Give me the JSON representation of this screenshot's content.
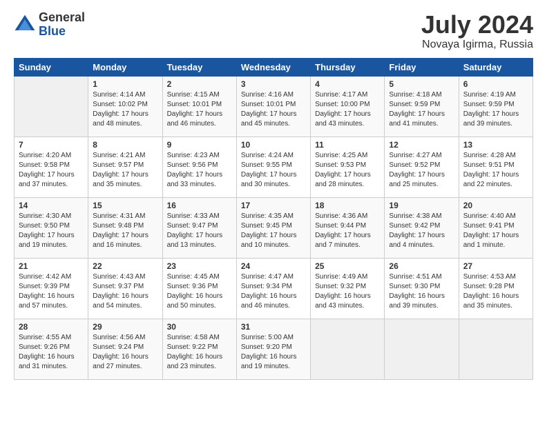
{
  "logo": {
    "general": "General",
    "blue": "Blue"
  },
  "header": {
    "month_year": "July 2024",
    "location": "Novaya Igirma, Russia"
  },
  "days_of_week": [
    "Sunday",
    "Monday",
    "Tuesday",
    "Wednesday",
    "Thursday",
    "Friday",
    "Saturday"
  ],
  "weeks": [
    [
      {
        "day": "",
        "info": ""
      },
      {
        "day": "1",
        "info": "Sunrise: 4:14 AM\nSunset: 10:02 PM\nDaylight: 17 hours\nand 48 minutes."
      },
      {
        "day": "2",
        "info": "Sunrise: 4:15 AM\nSunset: 10:01 PM\nDaylight: 17 hours\nand 46 minutes."
      },
      {
        "day": "3",
        "info": "Sunrise: 4:16 AM\nSunset: 10:01 PM\nDaylight: 17 hours\nand 45 minutes."
      },
      {
        "day": "4",
        "info": "Sunrise: 4:17 AM\nSunset: 10:00 PM\nDaylight: 17 hours\nand 43 minutes."
      },
      {
        "day": "5",
        "info": "Sunrise: 4:18 AM\nSunset: 9:59 PM\nDaylight: 17 hours\nand 41 minutes."
      },
      {
        "day": "6",
        "info": "Sunrise: 4:19 AM\nSunset: 9:59 PM\nDaylight: 17 hours\nand 39 minutes."
      }
    ],
    [
      {
        "day": "7",
        "info": "Sunrise: 4:20 AM\nSunset: 9:58 PM\nDaylight: 17 hours\nand 37 minutes."
      },
      {
        "day": "8",
        "info": "Sunrise: 4:21 AM\nSunset: 9:57 PM\nDaylight: 17 hours\nand 35 minutes."
      },
      {
        "day": "9",
        "info": "Sunrise: 4:23 AM\nSunset: 9:56 PM\nDaylight: 17 hours\nand 33 minutes."
      },
      {
        "day": "10",
        "info": "Sunrise: 4:24 AM\nSunset: 9:55 PM\nDaylight: 17 hours\nand 30 minutes."
      },
      {
        "day": "11",
        "info": "Sunrise: 4:25 AM\nSunset: 9:53 PM\nDaylight: 17 hours\nand 28 minutes."
      },
      {
        "day": "12",
        "info": "Sunrise: 4:27 AM\nSunset: 9:52 PM\nDaylight: 17 hours\nand 25 minutes."
      },
      {
        "day": "13",
        "info": "Sunrise: 4:28 AM\nSunset: 9:51 PM\nDaylight: 17 hours\nand 22 minutes."
      }
    ],
    [
      {
        "day": "14",
        "info": "Sunrise: 4:30 AM\nSunset: 9:50 PM\nDaylight: 17 hours\nand 19 minutes."
      },
      {
        "day": "15",
        "info": "Sunrise: 4:31 AM\nSunset: 9:48 PM\nDaylight: 17 hours\nand 16 minutes."
      },
      {
        "day": "16",
        "info": "Sunrise: 4:33 AM\nSunset: 9:47 PM\nDaylight: 17 hours\nand 13 minutes."
      },
      {
        "day": "17",
        "info": "Sunrise: 4:35 AM\nSunset: 9:45 PM\nDaylight: 17 hours\nand 10 minutes."
      },
      {
        "day": "18",
        "info": "Sunrise: 4:36 AM\nSunset: 9:44 PM\nDaylight: 17 hours\nand 7 minutes."
      },
      {
        "day": "19",
        "info": "Sunrise: 4:38 AM\nSunset: 9:42 PM\nDaylight: 17 hours\nand 4 minutes."
      },
      {
        "day": "20",
        "info": "Sunrise: 4:40 AM\nSunset: 9:41 PM\nDaylight: 17 hours\nand 1 minute."
      }
    ],
    [
      {
        "day": "21",
        "info": "Sunrise: 4:42 AM\nSunset: 9:39 PM\nDaylight: 16 hours\nand 57 minutes."
      },
      {
        "day": "22",
        "info": "Sunrise: 4:43 AM\nSunset: 9:37 PM\nDaylight: 16 hours\nand 54 minutes."
      },
      {
        "day": "23",
        "info": "Sunrise: 4:45 AM\nSunset: 9:36 PM\nDaylight: 16 hours\nand 50 minutes."
      },
      {
        "day": "24",
        "info": "Sunrise: 4:47 AM\nSunset: 9:34 PM\nDaylight: 16 hours\nand 46 minutes."
      },
      {
        "day": "25",
        "info": "Sunrise: 4:49 AM\nSunset: 9:32 PM\nDaylight: 16 hours\nand 43 minutes."
      },
      {
        "day": "26",
        "info": "Sunrise: 4:51 AM\nSunset: 9:30 PM\nDaylight: 16 hours\nand 39 minutes."
      },
      {
        "day": "27",
        "info": "Sunrise: 4:53 AM\nSunset: 9:28 PM\nDaylight: 16 hours\nand 35 minutes."
      }
    ],
    [
      {
        "day": "28",
        "info": "Sunrise: 4:55 AM\nSunset: 9:26 PM\nDaylight: 16 hours\nand 31 minutes."
      },
      {
        "day": "29",
        "info": "Sunrise: 4:56 AM\nSunset: 9:24 PM\nDaylight: 16 hours\nand 27 minutes."
      },
      {
        "day": "30",
        "info": "Sunrise: 4:58 AM\nSunset: 9:22 PM\nDaylight: 16 hours\nand 23 minutes."
      },
      {
        "day": "31",
        "info": "Sunrise: 5:00 AM\nSunset: 9:20 PM\nDaylight: 16 hours\nand 19 minutes."
      },
      {
        "day": "",
        "info": ""
      },
      {
        "day": "",
        "info": ""
      },
      {
        "day": "",
        "info": ""
      }
    ]
  ]
}
